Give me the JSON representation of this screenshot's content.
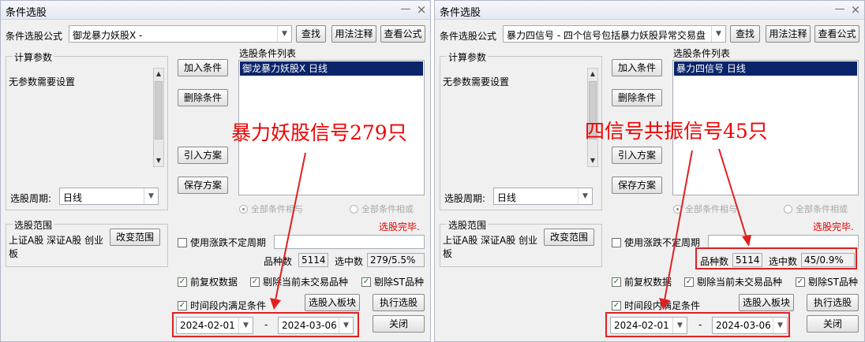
{
  "panels": [
    {
      "title": "条件选股",
      "formula_label": "条件选股公式",
      "formula_value": "御龙暴力妖股X  -",
      "find_btn": "查找",
      "usage_btn": "用法注释",
      "view_btn": "查看公式",
      "params_title": "计算参数",
      "params_text": "无参数需要设置",
      "add_btn": "加入条件",
      "del_btn": "删除条件",
      "import_btn": "引入方案",
      "save_btn": "保存方案",
      "list_title": "选股条件列表",
      "list_item": "御龙暴力妖股X  日线",
      "period_label": "选股周期:",
      "period_value": "日线",
      "radio_and": "全部条件相与",
      "radio_or": "全部条件相或",
      "status": "选股完毕.",
      "range_title": "选股范围",
      "range_text": "上证A股 深证A股 创业板",
      "change_range_btn": "改变范围",
      "chk_period": "使用涨跌不定周期",
      "count_label": "品种数",
      "count_value": "5114",
      "selected_label": "选中数",
      "selected_value": "279/5.5%",
      "chk_adjust": "前复权数据",
      "chk_exclude_untraded": "剔除当前未交易品种",
      "chk_exclude_st": "剔除ST品种",
      "chk_time_range": "时间段内满足条件",
      "to_block_btn": "选股入板块",
      "run_btn": "执行选股",
      "date_from": "2024-02-01",
      "date_sep": "-",
      "date_to": "2024-03-06",
      "close_btn": "关闭",
      "annotation": "暴力妖股信号279只"
    },
    {
      "title": "条件选股",
      "formula_label": "条件选股公式",
      "formula_value": "暴力四信号  -  四个信号包括暴力妖股异常交易盘",
      "find_btn": "查找",
      "usage_btn": "用法注释",
      "view_btn": "查看公式",
      "params_title": "计算参数",
      "params_text": "无参数需要设置",
      "add_btn": "加入条件",
      "del_btn": "删除条件",
      "import_btn": "引入方案",
      "save_btn": "保存方案",
      "list_title": "选股条件列表",
      "list_item": "暴力四信号  日线",
      "period_label": "选股周期:",
      "period_value": "日线",
      "radio_and": "全部条件相与",
      "radio_or": "全部条件相或",
      "status": "选股完毕.",
      "range_title": "选股范围",
      "range_text": "上证A股 深证A股 创业板",
      "change_range_btn": "改变范围",
      "chk_period": "使用涨跌不定周期",
      "count_label": "品种数",
      "count_value": "5114",
      "selected_label": "选中数",
      "selected_value": "45/0.9%",
      "chk_adjust": "前复权数据",
      "chk_exclude_untraded": "剔除当前未交易品种",
      "chk_exclude_st": "剔除ST品种",
      "chk_time_range": "时间段内满足条件",
      "to_block_btn": "选股入板块",
      "run_btn": "执行选股",
      "date_from": "2024-02-01",
      "date_sep": "-",
      "date_to": "2024-03-06",
      "close_btn": "关闭",
      "annotation": "四信号共振信号45只"
    }
  ],
  "icons": {
    "minimize": "minimize-icon",
    "close": "close-icon",
    "dropdown": "chevron-down-icon",
    "check": "checkmark-icon"
  },
  "colors": {
    "annotation": "#f00000",
    "status": "#e00000",
    "selection": "#0a246a"
  }
}
